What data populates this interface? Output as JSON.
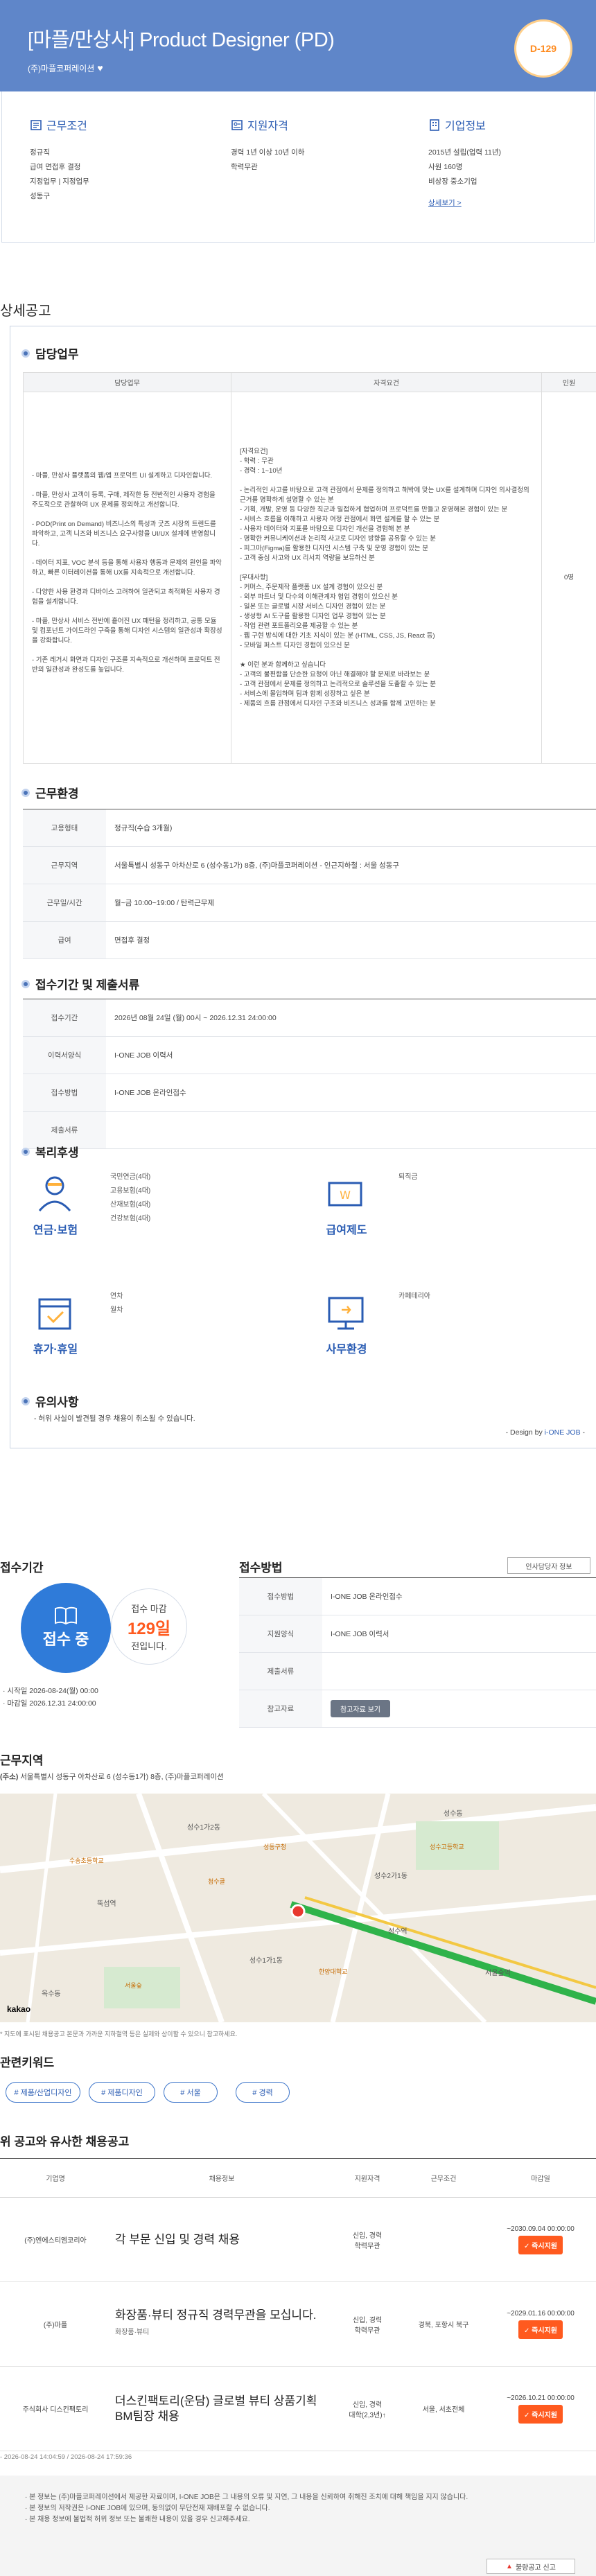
{
  "header": {
    "title": "[마플/만상사] Product Designer (PD)",
    "company": "(주)마플코퍼레이션",
    "dday": "D-129",
    "heart_icon": "heart-icon"
  },
  "summary": {
    "conditions": {
      "title": "근무조건",
      "lines": [
        "정규직",
        "급여 면접후 결정",
        "지정업무 | 지정업무",
        "성동구"
      ]
    },
    "qualification": {
      "title": "지원자격",
      "lines": [
        "경력 1년 이상 10년 이하",
        "학력무관"
      ]
    },
    "company": {
      "title": "기업정보",
      "lines": [
        "2015년 설립(업력 11년)",
        "사원 160명",
        "비상장 중소기업"
      ],
      "more": "상세보기 >"
    }
  },
  "detail": {
    "title": "상세공고",
    "duty": {
      "title": "담당업무",
      "headers": [
        "담당업무",
        "자격요건",
        "인원"
      ],
      "duties": [
        "- 마플, 만상사 플랫폼의 웹/앱 프로덕트 UI 설계하고 디자인합니다.",
        "- 마플, 만상사 고객이 등록, 구매, 제작한 등 전반적인 사용자 경험을 주도적으로 관찰하며 UX 문제를 정의하고 개선합니다.",
        "- POD(Print on Demand) 비즈니스의 특성과 굿즈 시장의 트렌드를 파악하고, 고객 니즈와 비즈니스 요구사항을 UI/UX 설계에 반영합니다.",
        "- 데이터 지표, VOC 분석 등을 통해 사용자 행동과 문제의 원인을 파악하고, 빠른 이터레이션을 통해 UX를 지속적으로 개선합니다.",
        "- 다양한 사용 환경과 디바이스 고려하여 일관되고 최적화된 사용자 경험을 설계합니다.",
        "- 마플, 만상사 서비스 전반에 흩어진 UX 패턴을 정리하고, 공통 모듈 및 컴포넌트 가이드라인 구축을 통해 디자인 시스템의 일관성과 확장성을 강화합니다.",
        "- 기존 레거시 화면과 디자인 구조를 지속적으로 개선하며 프로덕트 전반의 일관성과 완성도를 높입니다."
      ],
      "requirements": [
        "[자격요건]",
        "- 학력 : 무관",
        "- 경력 : 1~10년",
        "",
        "- 논리적인 사고를 바탕으로 고객 관점에서 문제를 정의하고 해박에 맞는 UX를 설계하며 디자인 의사결정의 근거를 명확하게 설명할 수 있는 분",
        "- 기획, 개발, 운영 등 다양한 직군과 밀접하게 협업하며 프로덕트를 만들고 운영해본 경험이 있는 분",
        "- 서비스 흐름을 이해하고 사용자 여정 관점에서 화면 설계를 할 수 있는 분",
        "- 사용자 데이터와 지표를 바탕으로 디자인 개선을 경험해 본 분",
        "- 명확한 커뮤니케이션과 논리적 사고로 디자인 방향을 공유할 수 있는 분",
        "- 피그마(Figma)를 활용한 디자인 시스템 구축 및 운영 경험이 있는 분",
        "- 고객 중심 사고와 UX 리서치 역량을 보유하신 분",
        "",
        "[우대사항]",
        "- 커머스, 주문제작 플랫폼 UX 설계 경험이 있으신 분",
        "- 외부 파트너 및 다수의 이해관계자 협업 경험이 있으신 분",
        "- 일본 또는 글로벌 시장 서비스 디자인 경험이 있는 분",
        "- 생성형 AI 도구를 활용한 디자인 업무 경험이 있는 분",
        "- 작업 관련 포트폴리오를 제공할 수 있는 분",
        "- 웹 구현 방식에 대한 기초 지식이 있는 분 (HTML, CSS, JS, React 등)",
        "- 모바일 퍼스트 디자인 경험이 있으신 분",
        "",
        "★ 이런 분과 함께하고 싶습니다",
        "- 고객의 불편함을 단순한 요청이 아닌 해결해야 할 문제로 바라보는 분",
        "- 고객 관점에서 문제를 정의하고 논리적으로 솔루션을 도출할 수 있는 분",
        "- 서비스에 몰입하며 팀과 함께 성장하고 싶은 분",
        "- 제품의 흐름 관점에서 디자인 구조와 비즈니스 성과를 함께 고민하는 분"
      ],
      "headcount": "0명"
    },
    "conditions": {
      "title": "근무환경",
      "rows": [
        {
          "k": "고용형태",
          "v": "정규직(수습 3개월)"
        },
        {
          "k": "근무지역",
          "v": "서울특별시 성동구 아차산로 6 (성수동1가) 8층, (주)마플코퍼레이션 - 인근지하철 : 서울 성동구"
        },
        {
          "k": "근무일/시간",
          "v": "월~금 10:00~19:00 / 탄력근무제"
        },
        {
          "k": "급여",
          "v": "면접후 결정"
        }
      ]
    },
    "period": {
      "title": "접수기간 및 제출서류",
      "rows": [
        {
          "k": "접수기간",
          "v": "2026년 08월 24일 (월) 00시 ~ 2026.12.31 24:00:00"
        },
        {
          "k": "이력서양식",
          "v": "I-ONE JOB 이력서"
        },
        {
          "k": "접수방법",
          "v": "I-ONE JOB 온라인접수"
        },
        {
          "k": "제출서류",
          "v": ""
        }
      ]
    },
    "welfare": {
      "title": "복리후생",
      "groups": [
        {
          "label": "연금·보험",
          "icon": "pension-icon",
          "items": [
            "국민연금(4대)",
            "고용보험(4대)",
            "산재보험(4대)",
            "건강보험(4대)"
          ]
        },
        {
          "label": "급여제도",
          "icon": "salary-icon",
          "items": [
            "퇴직금"
          ]
        },
        {
          "label": "휴가·휴일",
          "icon": "calendar-icon",
          "items": [
            "연차",
            "월차"
          ]
        },
        {
          "label": "사무환경",
          "icon": "monitor-icon",
          "items": [
            "카페테리아"
          ]
        }
      ]
    },
    "notice": {
      "title": "유의사항",
      "text": "- 허위 사실이 발견될 경우 채용이 취소될 수 있습니다."
    },
    "design_by": "- Design by ",
    "design_link": "i-ONE JOB",
    "design_tail": " -"
  },
  "apply": {
    "title": "접수기간",
    "status": "접수 중",
    "remain_label": "접수 마감",
    "remain_days": "129일",
    "remain_tail": "전입니다.",
    "start": "· 시작일 2026-08-24(월) 00:00",
    "end": "· 마감일 2026.12.31 24:00:00",
    "method_title": "접수방법",
    "scrap": "인사담당자 정보",
    "rows": [
      {
        "k": "접수방법",
        "v": "I-ONE JOB 온라인접수"
      },
      {
        "k": "지원양식",
        "v": "I-ONE JOB 이력서"
      },
      {
        "k": "제출서류",
        "v": ""
      },
      {
        "k": "참고자료",
        "v": "참고자료 보기"
      }
    ]
  },
  "location": {
    "title": "근무지역",
    "address_prefix": "(주소)",
    "address": "서울특별시 성동구 아차산로 6 (성수동1가) 8층, (주)마플코퍼레이션",
    "map_labels": [
      "성수1가2동",
      "성수동",
      "성수1가1동",
      "뚝섬역",
      "성수역",
      "서울숲역",
      "옥수동",
      "성수2가1동"
    ],
    "map_pois": [
      "수송초등학교",
      "성수고등학교",
      "한양대학교",
      "서울숲",
      "청수골",
      "성동구청"
    ],
    "map_brand": "kakao",
    "map_note": "* 지도에 표시된 채용공고 본문과 가까운 지하철역 등은 실제와 상이할 수 있으니 참고하세요."
  },
  "keywords": {
    "title": "관련키워드",
    "tags": [
      "# 제품/산업디자인",
      "# 제품디자인",
      "# 서울",
      "# 경력"
    ]
  },
  "similar": {
    "title": "위 공고와 유사한 채용공고",
    "headers": [
      "기업명",
      "채용정보",
      "지원자격",
      "근무조건",
      "마감일"
    ],
    "rows": [
      {
        "company": "(주)엔에스티엠코리아",
        "title": "각 부문 신입 및 경력 채용",
        "sub": "",
        "qual": "신입, 경력\n학력무관",
        "cond": "",
        "due": "~2030.09.04 00:00:00",
        "apply": "✓ 즉시지원"
      },
      {
        "company": "(주)마플",
        "title": "화장품·뷰티 정규직 경력무관을 모십니다.",
        "sub": "화장품·뷰티",
        "qual": "신입, 경력\n학력무관",
        "cond": "경북, 포항시 북구",
        "due": "~2029.01.16 00:00:00",
        "apply": "✓ 즉시지원"
      },
      {
        "company": "주식회사 디스킨팩토리",
        "title": "더스킨팩토리(운담) 글로벌 뷰티 상품기획 BM팀장 채용",
        "sub": "",
        "qual": "신입, 경력\n대학(2,3년)↑",
        "cond": "서울, 서초전체",
        "due": "~2026.10.21 00:00:00",
        "apply": "✓ 즉시지원"
      }
    ],
    "dates": "- 2026-08-24 14:04:59 / 2026-08-24 17:59:36"
  },
  "footer": {
    "lines": [
      "본 정보는 (주)마플코퍼레이션에서 제공한 자료이며, I-ONE JOB은 그 내용의 오류 및 지연, 그 내용을 신뢰하여 취해진 조치에 대해 책임을 지지 않습니다.",
      "본 정보의 저작권은 I-ONE JOB에 있으며, 동의없이 무단전재 재배포할 수 없습니다.",
      "본 채용 정보에 불법적 허위 정보 또는 불쾌한 내용이 있을 경우 신고해주세요."
    ],
    "report": "불량공고 신고"
  },
  "colors": {
    "header": "#5f86c9",
    "accent": "#2b5cb3",
    "orange": "#ff5a1f",
    "green": "#2fb34a"
  }
}
